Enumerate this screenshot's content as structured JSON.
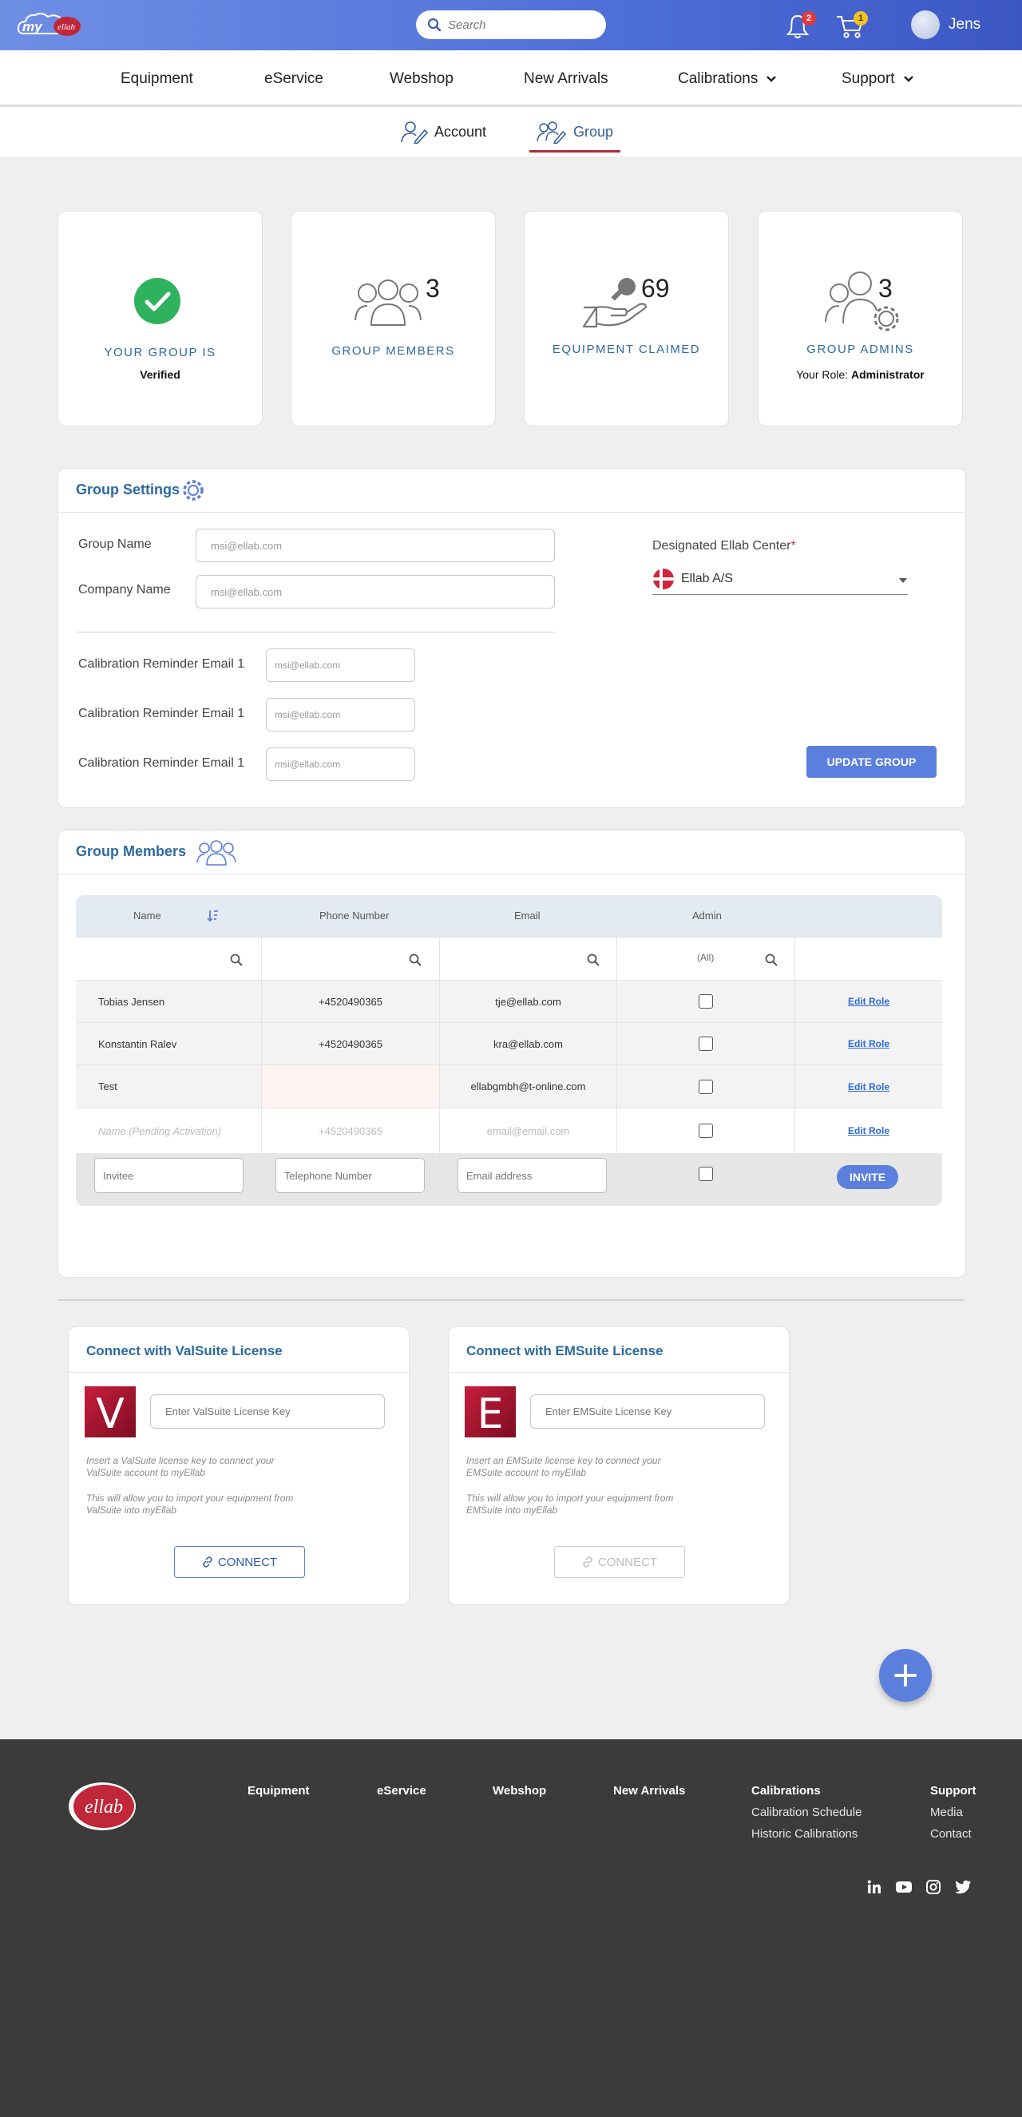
{
  "header": {
    "logo_text": "my",
    "logo_badge": "ellab",
    "search_placeholder": "Search",
    "notifications_count": "2",
    "cart_count": "1",
    "user_name": "Jens"
  },
  "nav": {
    "items": [
      "Equipment",
      "eService",
      "Webshop",
      "New Arrivals",
      "Calibrations",
      "Support"
    ]
  },
  "subnav": {
    "account": "Account",
    "group": "Group"
  },
  "stats": {
    "verified_label": "YOUR GROUP IS",
    "verified_value": "Verified",
    "members_count": "3",
    "members_label": "GROUP MEMBERS",
    "equipment_count": "69",
    "equipment_label": "EQUIPMENT CLAIMED",
    "admins_count": "3",
    "admins_label": "GROUP ADMINS",
    "role_prefix": "Your Role:",
    "role_value": "Administrator"
  },
  "settings": {
    "title": "Group Settings",
    "group_name_label": "Group Name",
    "group_name_value": "msi@ellab.com",
    "company_name_label": "Company Name",
    "company_name_value": "msi@ellab.com",
    "reminder_label": "Calibration Reminder Email 1",
    "reminder_values": [
      "msi@ellab.com",
      "msi@ellab.com",
      "msi@ellab.com"
    ],
    "center_label": "Designated Ellab Center",
    "center_required": "*",
    "center_value": "Ellab A/S",
    "update_button": "UPDATE GROUP"
  },
  "members": {
    "title": "Group Members",
    "columns": {
      "name": "Name",
      "phone": "Phone Number",
      "email": "Email",
      "admin": "Admin"
    },
    "admin_filter": "(All)",
    "rows": [
      {
        "name": "Tobias Jensen",
        "phone": "+4520490365",
        "email": "tje@ellab.com",
        "action": "Edit Role"
      },
      {
        "name": "Konstantin Ralev",
        "phone": "+4520490365",
        "email": "kra@ellab.com",
        "action": "Edit Role"
      },
      {
        "name": "Test",
        "phone": "",
        "email": "ellabgmbh@t-online.com",
        "action": "Edit Role"
      },
      {
        "name": "Name (Pending Activation)",
        "phone": "+4520490365",
        "email": "email@email.com",
        "action": "Edit Role"
      }
    ],
    "invite": {
      "name_placeholder": "Invitee",
      "phone_placeholder": "Telephone Number",
      "email_placeholder": "Email address",
      "button": "INVITE"
    }
  },
  "licenses": {
    "valsuite": {
      "title": "Connect with ValSuite License",
      "logo_letter": "V",
      "placeholder": "Enter ValSuite License Key",
      "text1": "Insert a ValSuite license key to connect your ValSuite account to myEllab",
      "text2": "This will allow you to import your equipment from ValSuite into myEllab",
      "button": "CONNECT"
    },
    "emsuite": {
      "title": "Connect with EMSuite License",
      "logo_letter": "E",
      "placeholder": "Enter EMSuite License Key",
      "text1": "Insert an EMSuite license key to connect your EMSuite account to myEllab",
      "text2": "This will allow you to import your equipment from EMSuite into myEllab",
      "button": "CONNECT"
    }
  },
  "footer": {
    "logo_text": "ellab",
    "links": {
      "equipment": "Equipment",
      "eservice": "eService",
      "webshop": "Webshop",
      "new_arrivals": "New Arrivals",
      "calibrations": "Calibrations",
      "calibration_schedule": "Calibration Schedule",
      "historic_calibrations": "Historic Calibrations",
      "support": "Support",
      "media": "Media",
      "contact": "Contact"
    }
  },
  "colors": {
    "brand_blue": "#5b7fdd",
    "title_blue": "#2c6aa0",
    "ellab_red": "#b12a3a",
    "verified_green": "#2fb25e",
    "footer_bg": "#3b3b3b"
  }
}
